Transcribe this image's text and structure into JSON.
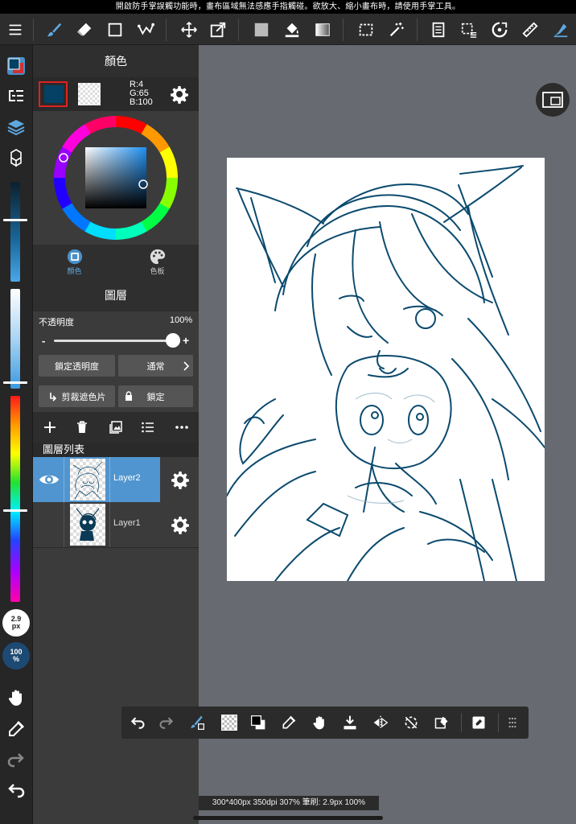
{
  "banner": {
    "text": "開啟防手掌誤觸功能時，畫布區域無法感應手指觸碰。欲放大、縮小畫布時，請使用手掌工具。"
  },
  "color_panel": {
    "title": "顏色",
    "rgb": {
      "r": "R:4",
      "g": "G:65",
      "b": "B:100"
    },
    "main_color": "#044164",
    "tabs": [
      {
        "label": "顏色"
      },
      {
        "label": "色板"
      }
    ]
  },
  "layer_panel": {
    "title": "圖層",
    "opacity_label": "不透明度",
    "opacity_value": "100%",
    "opacity_fraction": 1.0,
    "minus": "-",
    "plus": "+",
    "lock_alpha_label": "鎖定透明度",
    "blend_mode_label": "通常",
    "clipping_label": "剪裁遮色片",
    "lock_label": "鎖定",
    "list_title": "圖層列表",
    "layers": [
      {
        "name": "Layer2",
        "selected": true,
        "visible": true
      },
      {
        "name": "Layer1",
        "selected": false,
        "visible": false
      }
    ]
  },
  "left_tools": {
    "brush_size": {
      "value": "2.9",
      "unit": "px"
    },
    "opacity_badge": {
      "value": "100",
      "unit": "%"
    },
    "brush_size_slider_fraction": 0.27,
    "value_slider_fraction": 0.9,
    "hue_slider_fraction": 0.55
  },
  "status_bar": {
    "text": "300*400px 350dpi 307% 筆刷: 2.9px 100%"
  },
  "colors": {
    "accent_blue": "#4a90c8",
    "selected_layer_bg": "#5095cf",
    "line_art": "#0b4a6e"
  }
}
